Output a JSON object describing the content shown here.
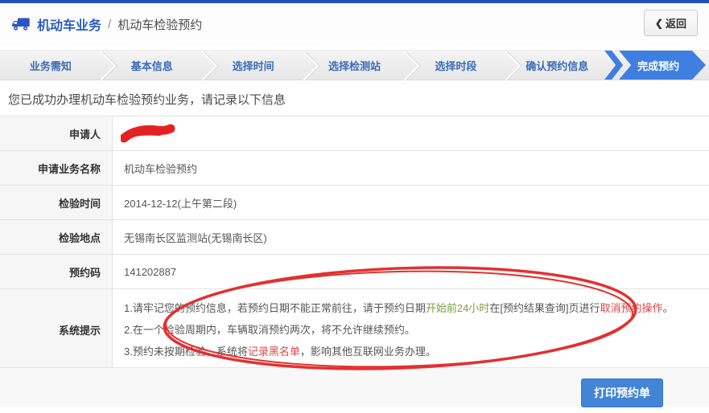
{
  "header": {
    "breadcrumb": {
      "root": "机动车业务",
      "separator": "/",
      "current": "机动车检验预约"
    },
    "back_button": {
      "chevron": "❮",
      "label": "返回"
    }
  },
  "wizard": {
    "steps": [
      {
        "label": "业务需知",
        "active": false
      },
      {
        "label": "基本信息",
        "active": false
      },
      {
        "label": "选择时间",
        "active": false
      },
      {
        "label": "选择检测站",
        "active": false
      },
      {
        "label": "选择时段",
        "active": false
      },
      {
        "label": "确认预约信息",
        "active": false
      },
      {
        "label": "完成预约",
        "active": true
      }
    ]
  },
  "main": {
    "success_message": "您已成功办理机动车检验预约业务，请记录以下信息"
  },
  "table": {
    "rows": [
      {
        "label": "申请人",
        "value": "",
        "redacted": true
      },
      {
        "label": "申请业务名称",
        "value": "机动车检验预约",
        "redacted": false
      },
      {
        "label": "检验时间",
        "value": "2014-12-12(上午第二段)",
        "redacted": false
      },
      {
        "label": "检验地点",
        "value": "无锡南长区监测站(无锡南长区)",
        "redacted": false
      },
      {
        "label": "预约码",
        "value": "141202887",
        "redacted": false
      }
    ],
    "system_row": {
      "label": "系统提示",
      "notes": [
        {
          "segments": [
            {
              "text": "1.请牢记您的预约信息，若预约日期不能正常前往，请于预约日期",
              "color": "default"
            },
            {
              "text": "开始前24小时",
              "color": "green"
            },
            {
              "text": "在[预约结果查询]页进行",
              "color": "default"
            },
            {
              "text": "取消预约操作",
              "color": "red"
            },
            {
              "text": "。",
              "color": "default"
            }
          ]
        },
        {
          "segments": [
            {
              "text": "2.在一个检验周期内，车辆取消预约两次，将不允许继续预约。",
              "color": "default"
            }
          ]
        },
        {
          "segments": [
            {
              "text": "3.预约未按期检验，系统将",
              "color": "default"
            },
            {
              "text": "记录黑名单",
              "color": "red"
            },
            {
              "text": "，影响其他互联网业务办理。",
              "color": "default"
            }
          ]
        }
      ]
    }
  },
  "footer": {
    "print_label": "打印预约单"
  },
  "colors": {
    "top_bar_blue": "#2251b5",
    "brand_blue": "#2a5cc0",
    "active_step_blue": "#3f7fe0",
    "print_button_blue": "#4285d6",
    "note_green": "#7b9d3f",
    "note_red": "#e04343",
    "annotation_red": "#e23131"
  }
}
